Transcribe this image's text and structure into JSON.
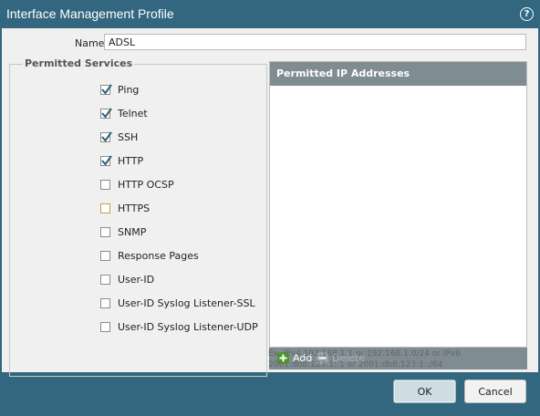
{
  "window": {
    "title": "Interface Management Profile",
    "help_glyph": "?"
  },
  "name_field": {
    "label": "Name",
    "value": "ADSL"
  },
  "permitted_services": {
    "legend": "Permitted Services",
    "items": [
      {
        "label": "Ping",
        "checked": true
      },
      {
        "label": "Telnet",
        "checked": true
      },
      {
        "label": "SSH",
        "checked": true
      },
      {
        "label": "HTTP",
        "checked": true
      },
      {
        "label": "HTTP OCSP",
        "checked": false
      },
      {
        "label": "HTTPS",
        "checked": false,
        "focused": true
      },
      {
        "label": "SNMP",
        "checked": false
      },
      {
        "label": "Response Pages",
        "checked": false
      },
      {
        "label": "User-ID",
        "checked": false
      },
      {
        "label": "User-ID Syslog Listener-SSL",
        "checked": false
      },
      {
        "label": "User-ID Syslog Listener-UDP",
        "checked": false
      }
    ]
  },
  "permitted_ip": {
    "header": "Permitted IP Addresses",
    "add_label": "Add",
    "delete_label": "Delete",
    "hint": "Ex. IPv4 192.168.1.1 or 192.168.1.0/24 or IPv6 2001:db8:123:1::1 or 2001:db8:123:1::/64"
  },
  "footer": {
    "ok_label": "OK",
    "cancel_label": "Cancel"
  },
  "colors": {
    "title_bar": "#33667f",
    "panel_header": "#7f8c92",
    "add_icon": "#4a9a2a"
  }
}
